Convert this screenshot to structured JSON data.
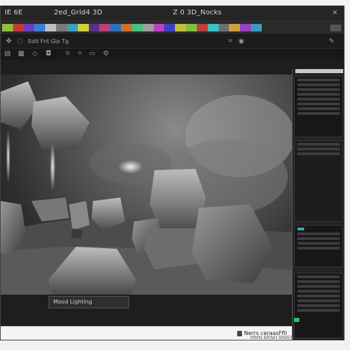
{
  "titlebar": {
    "app_title": "IE 6E",
    "document_title": "2ed_Grid4 3D",
    "panel_title": "Z 0 3D_Nocks",
    "close_glyph": "×"
  },
  "ribbon": {
    "swatch_colors": [
      "#8fbf3f",
      "#c43a3a",
      "#6a3fbf",
      "#3a7fd0",
      "#c0c0c0",
      "#7a7a7a",
      "#3fa0c0",
      "#d0d040",
      "#5a2f8a",
      "#bf3f7a",
      "#2f6fbf",
      "#d06f2f",
      "#4fbf7f",
      "#a0a0a0",
      "#c03fbf",
      "#3f3fbf",
      "#bfbf3f",
      "#7fbf3f",
      "#bf3f3f",
      "#3fbfbf",
      "#6f6f6f",
      "#d0a03f",
      "#9a3fbf",
      "#3f9abf"
    ]
  },
  "toolbar": {
    "menu_label": "Edit  Fnt  Glp  Tg",
    "icons": [
      "move-icon",
      "lasso-icon",
      "crop-icon",
      "eye-icon",
      "brush-icon",
      "layers-icon",
      "grid-icon",
      "mesh-icon",
      "camera-icon",
      "render-icon"
    ]
  },
  "viewport": {
    "scene": "3D rock render"
  },
  "caption": {
    "text": "Mood Lighting"
  },
  "statusbar": {
    "text": "Nerrs ceraasFfil",
    "subtext": "MMN BRNH BNIEN"
  },
  "colors": {
    "accent_teal": "#3aa8b8",
    "accent_green": "#2cbf5a",
    "frame_accent": "#8a2f4d"
  }
}
